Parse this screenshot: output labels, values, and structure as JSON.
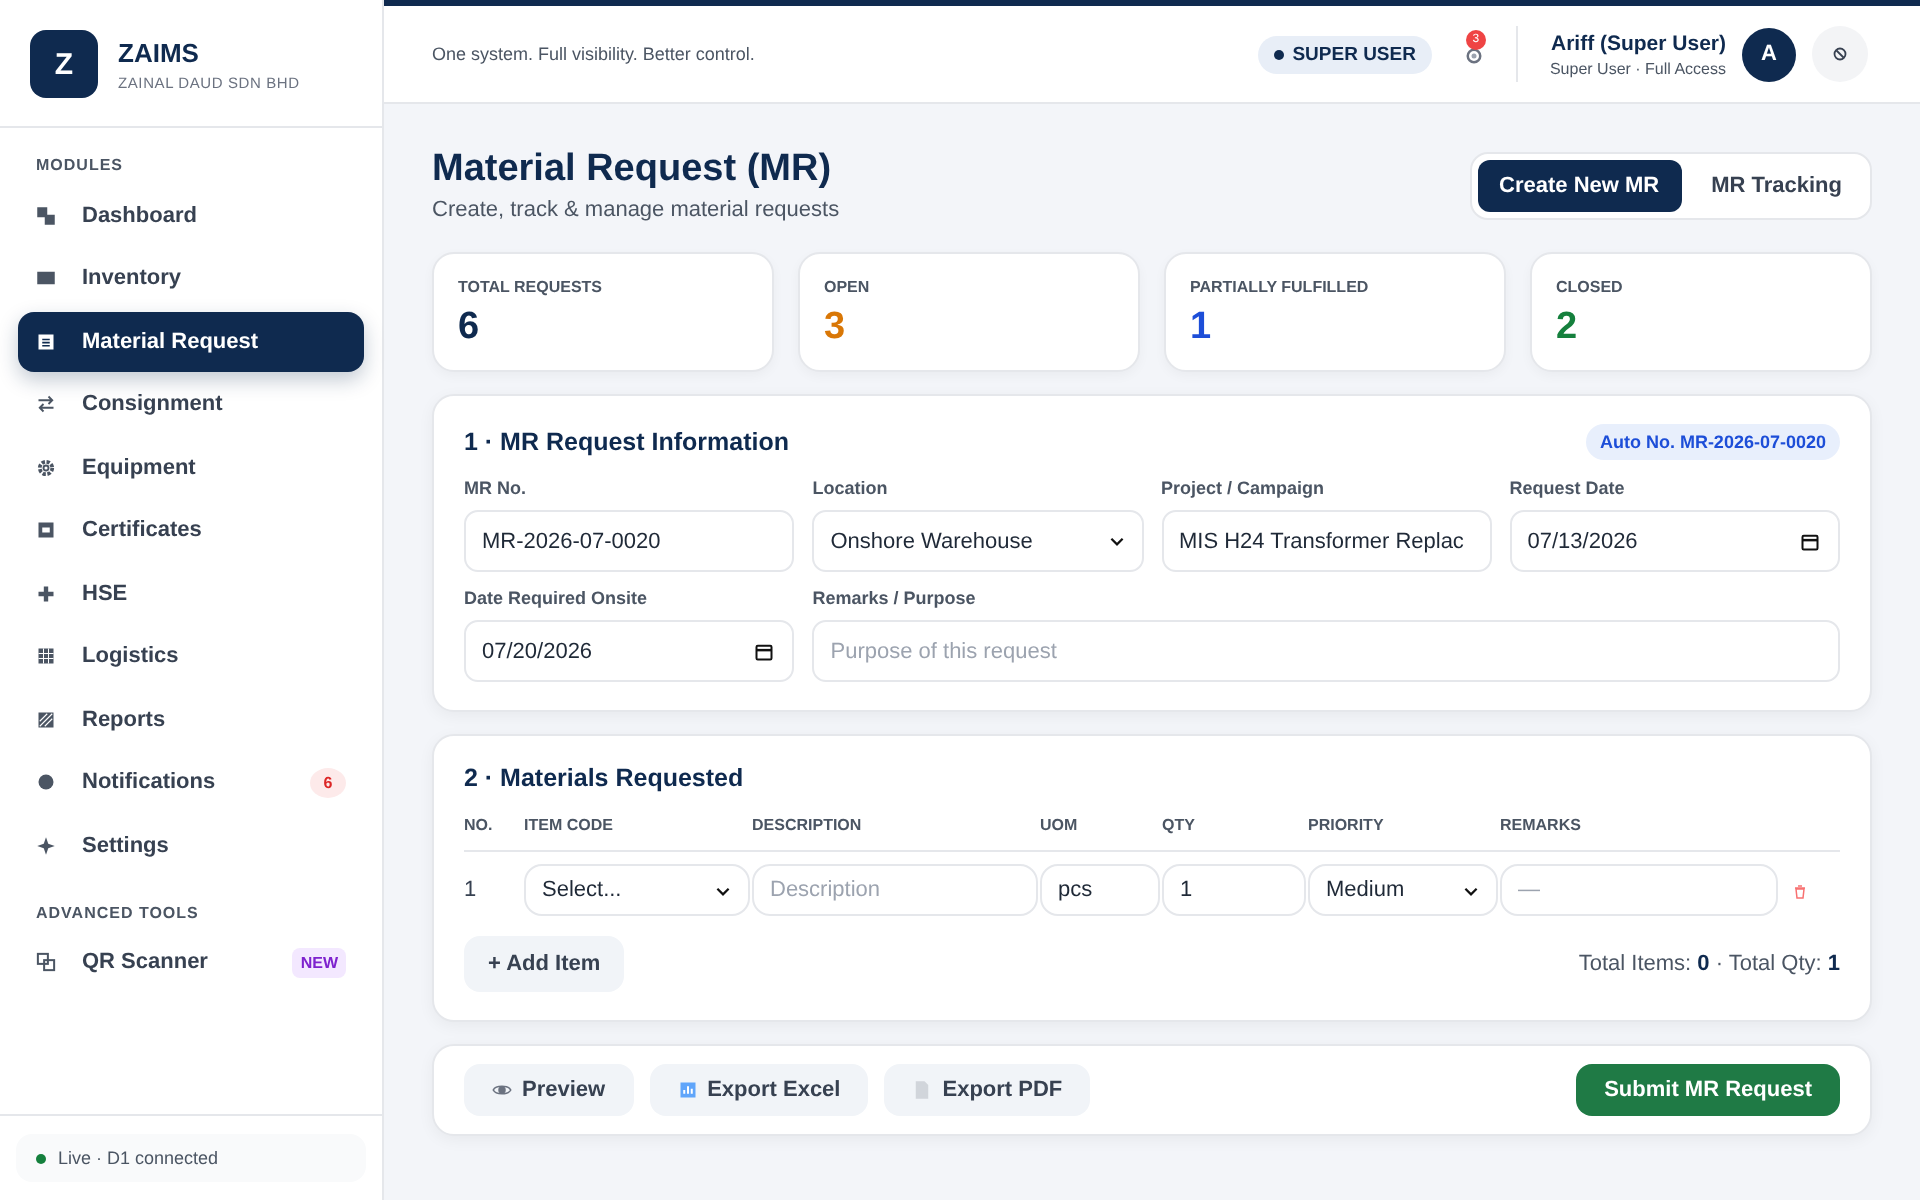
{
  "brand": {
    "logo": "Z",
    "name": "ZAIMS",
    "company": "ZAINAL DAUD SDN BHD"
  },
  "sidebar": {
    "sections": [
      {
        "heading": "MODULES",
        "items": [
          {
            "label": "Dashboard",
            "selected": false
          },
          {
            "label": "Inventory",
            "selected": false
          },
          {
            "label": "Material Request",
            "selected": true
          },
          {
            "label": "Consignment",
            "selected": false
          },
          {
            "label": "Equipment",
            "selected": false
          },
          {
            "label": "Certificates",
            "selected": false
          },
          {
            "label": "HSE",
            "selected": false
          },
          {
            "label": "Logistics",
            "selected": false
          },
          {
            "label": "Reports",
            "selected": false
          },
          {
            "label": "Notifications",
            "selected": false,
            "badge": {
              "text": "6",
              "kind": "count"
            }
          },
          {
            "label": "Settings",
            "selected": false
          }
        ]
      },
      {
        "heading": "ADVANCED TOOLS",
        "items": [
          {
            "label": "QR Scanner",
            "selected": false,
            "badge": {
              "text": "NEW",
              "kind": "new"
            }
          }
        ]
      }
    ],
    "status": "Live · D1 connected"
  },
  "topbar": {
    "tagline": "One system. Full visibility. Better control.",
    "role_badge": "SUPER USER",
    "notification_count": "3",
    "user_name": "Ariff (Super User)",
    "user_role": "Super User · Full Access",
    "avatar": "A"
  },
  "page": {
    "title": "Material Request (MR)",
    "subtitle": "Create, track & manage material requests",
    "view_tabs": [
      {
        "label": "Create New MR",
        "selected": true
      },
      {
        "label": "MR Tracking",
        "selected": false
      }
    ]
  },
  "stats": [
    {
      "label": "TOTAL REQUESTS",
      "value": "6",
      "color": "#0f2a4f"
    },
    {
      "label": "OPEN",
      "value": "3",
      "color": "#d97706"
    },
    {
      "label": "PARTIALLY FULFILLED",
      "value": "1",
      "color": "#1d4ed8"
    },
    {
      "label": "CLOSED",
      "value": "2",
      "color": "#15803d"
    }
  ],
  "request_info": {
    "title": "1 · MR Request Information",
    "auto_no": "Auto No. MR-2026-07-0020",
    "fields": [
      {
        "label": "MR No.",
        "kind": "text",
        "value": "MR-2026-07-0020"
      },
      {
        "label": "Location",
        "kind": "select",
        "value": "Onshore Warehouse"
      },
      {
        "label": "Project / Campaign",
        "kind": "text",
        "value": "MIS H24 Transformer Replac"
      },
      {
        "label": "Request Date",
        "kind": "date",
        "value": "07/13/2026"
      },
      {
        "label": "Date Required Onsite",
        "kind": "date",
        "value": "07/20/2026"
      },
      {
        "label": "Remarks / Purpose",
        "kind": "wide",
        "placeholder": "Purpose of this request"
      }
    ]
  },
  "materials": {
    "title": "2 · Materials Requested",
    "columns": [
      "NO.",
      "ITEM CODE",
      "DESCRIPTION",
      "UOM",
      "QTY",
      "PRIORITY",
      "REMARKS"
    ],
    "rows": [
      {
        "cells": [
          {
            "kind": "number",
            "value": "1"
          },
          {
            "kind": "select",
            "value": "Select..."
          },
          {
            "kind": "text",
            "placeholder": "Description"
          },
          {
            "kind": "text",
            "value": "pcs"
          },
          {
            "kind": "text",
            "value": "1"
          },
          {
            "kind": "select",
            "value": "Medium"
          },
          {
            "kind": "text",
            "placeholder": "—"
          }
        ]
      }
    ],
    "add_button": "+ Add Item",
    "totals": "Total Items: **0** · Total Qty: **1**"
  },
  "actions": [
    {
      "label": "Preview",
      "kind": "secondary"
    },
    {
      "label": "Export Excel",
      "kind": "secondary"
    },
    {
      "label": "Export PDF",
      "kind": "secondary"
    },
    {
      "label": "Submit MR Request",
      "kind": "primary"
    }
  ]
}
